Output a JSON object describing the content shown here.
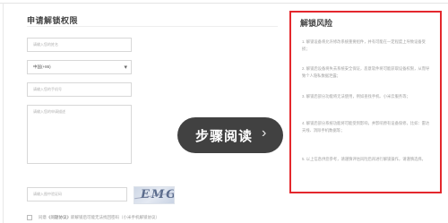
{
  "form": {
    "title": "申请解锁权限",
    "fields": {
      "real_name_placeholder": "请输入您的姓名",
      "region_value": "中国(+86)",
      "phone_placeholder": "请输入您的手机号",
      "description_placeholder": "请输入您的申请描述",
      "captcha_placeholder": "请输入图中验证码",
      "captcha_text": "EMGE"
    },
    "agreement": {
      "prefix": "同意",
      "strong": "《问题协议》",
      "suffix": "即解锁后可能无法找回密码（小米手机解锁协议）"
    }
  },
  "risk": {
    "title": "解锁风险",
    "items": [
      "1. 解锁设备将允许修改系统重要组件，并有可能在一定程度上导致设备受损；",
      "2. 解锁后设备将失去系统安全保证，恶意软件将可能获取设备权限，从而导致个人隐私数据泄露；",
      "3. 解锁后部分功能将无法使用，例如查找手机、小米云服务等；",
      "4. 解锁后部分系统功能将可能受到影响，并影响原有设备保修，比如：雷达天线、消除手机数据等；",
      "5. 以上信息供您参考，请谨慎评估风险后再进行解锁操作，请谨慎选择。"
    ]
  },
  "overlay": {
    "label": "步骤阅读",
    "icon": "chevron-right-icon"
  },
  "colors": {
    "risk_border": "#e4272d",
    "overlay_bg": "#222222"
  }
}
